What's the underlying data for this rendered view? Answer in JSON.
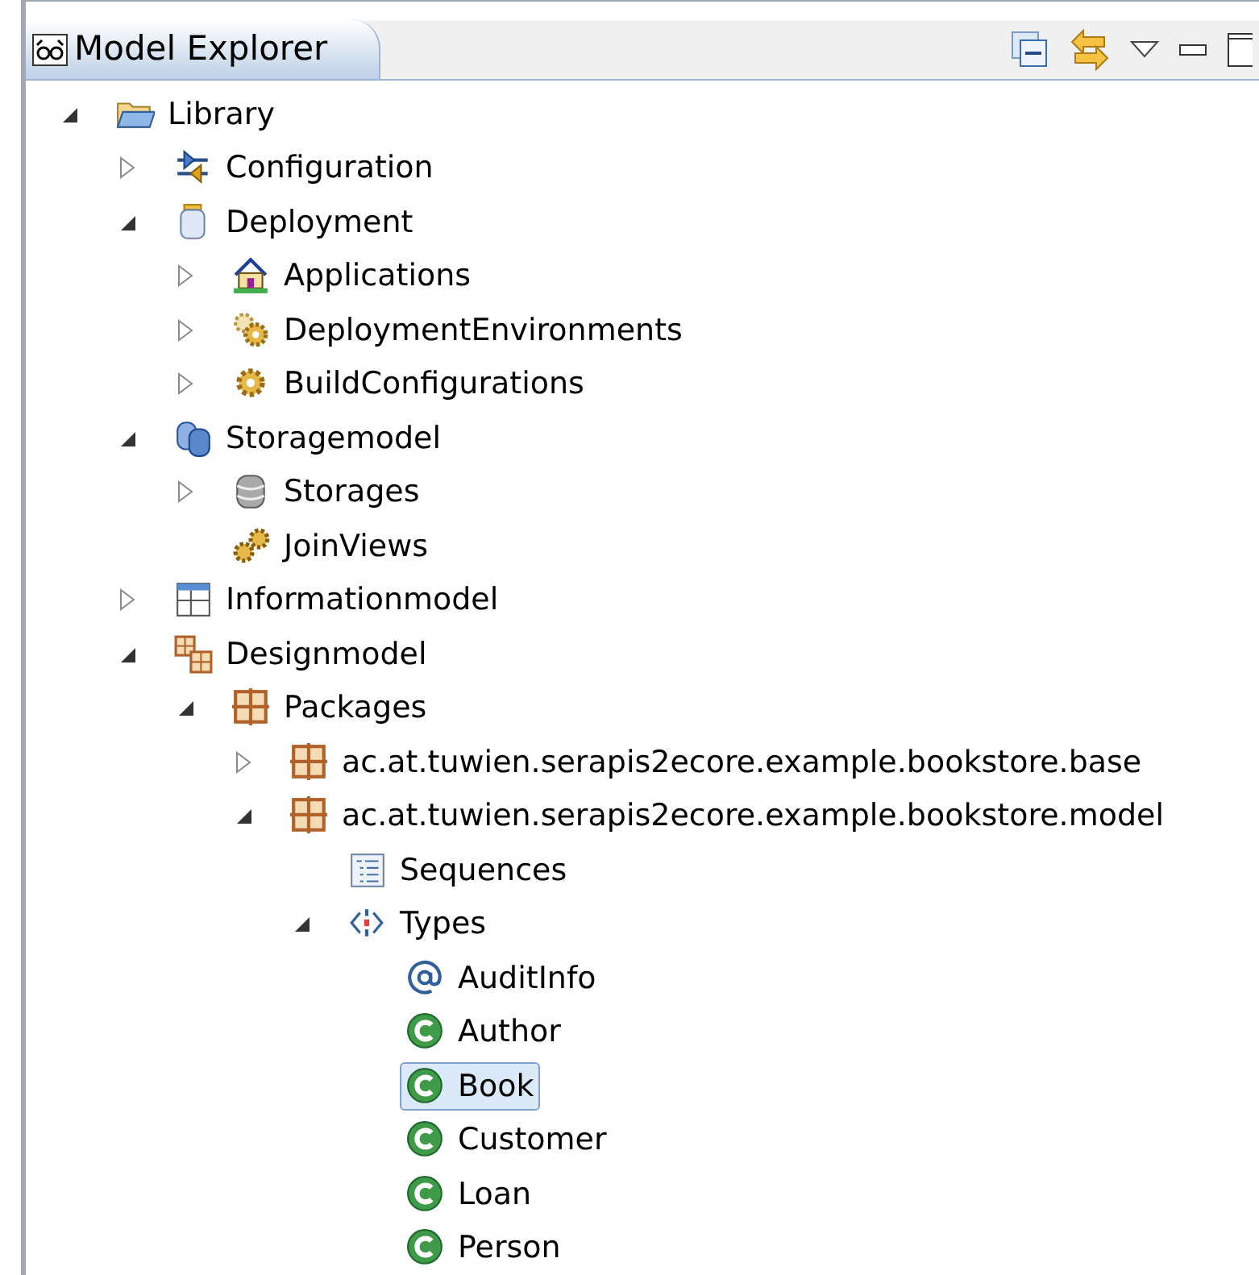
{
  "view": {
    "title": "Model Explorer"
  },
  "tree": [
    {
      "kind": "folder",
      "label": "Library",
      "expanded": true,
      "selected": false,
      "children": [
        {
          "kind": "config",
          "label": "Configuration",
          "expanded": false,
          "selected": false
        },
        {
          "kind": "jar",
          "label": "Deployment",
          "expanded": true,
          "selected": false,
          "children": [
            {
              "kind": "house",
              "label": "Applications",
              "expanded": false,
              "selected": false
            },
            {
              "kind": "gears",
              "label": "DeploymentEnvironments",
              "expanded": false,
              "selected": false
            },
            {
              "kind": "gear",
              "label": "BuildConfigurations",
              "expanded": false,
              "selected": false
            }
          ]
        },
        {
          "kind": "cylinders",
          "label": "Storagemodel",
          "expanded": true,
          "selected": false,
          "children": [
            {
              "kind": "database",
              "label": "Storages",
              "expanded": false,
              "selected": false
            },
            {
              "kind": "joingears",
              "label": "JoinViews",
              "selected": false
            }
          ]
        },
        {
          "kind": "table",
          "label": "Informationmodel",
          "expanded": false,
          "selected": false
        },
        {
          "kind": "designmodel",
          "label": "Designmodel",
          "expanded": true,
          "selected": false,
          "children": [
            {
              "kind": "package",
              "label": "Packages",
              "expanded": true,
              "selected": false,
              "children": [
                {
                  "kind": "package",
                  "label": "ac.at.tuwien.serapis2ecore.example.bookstore.base",
                  "expanded": false,
                  "selected": false
                },
                {
                  "kind": "package",
                  "label": "ac.at.tuwien.serapis2ecore.example.bookstore.model",
                  "expanded": true,
                  "selected": false,
                  "children": [
                    {
                      "kind": "sequences",
                      "label": "Sequences",
                      "selected": false
                    },
                    {
                      "kind": "types",
                      "label": "Types",
                      "expanded": true,
                      "selected": false,
                      "children": [
                        {
                          "kind": "annotation",
                          "label": "AuditInfo",
                          "selected": false
                        },
                        {
                          "kind": "class",
                          "label": "Author",
                          "selected": false
                        },
                        {
                          "kind": "class",
                          "label": "Book",
                          "selected": true
                        },
                        {
                          "kind": "class",
                          "label": "Customer",
                          "selected": false
                        },
                        {
                          "kind": "class",
                          "label": "Loan",
                          "selected": false
                        },
                        {
                          "kind": "class",
                          "label": "Person",
                          "selected": false
                        }
                      ]
                    }
                  ]
                }
              ]
            }
          ]
        }
      ]
    }
  ]
}
